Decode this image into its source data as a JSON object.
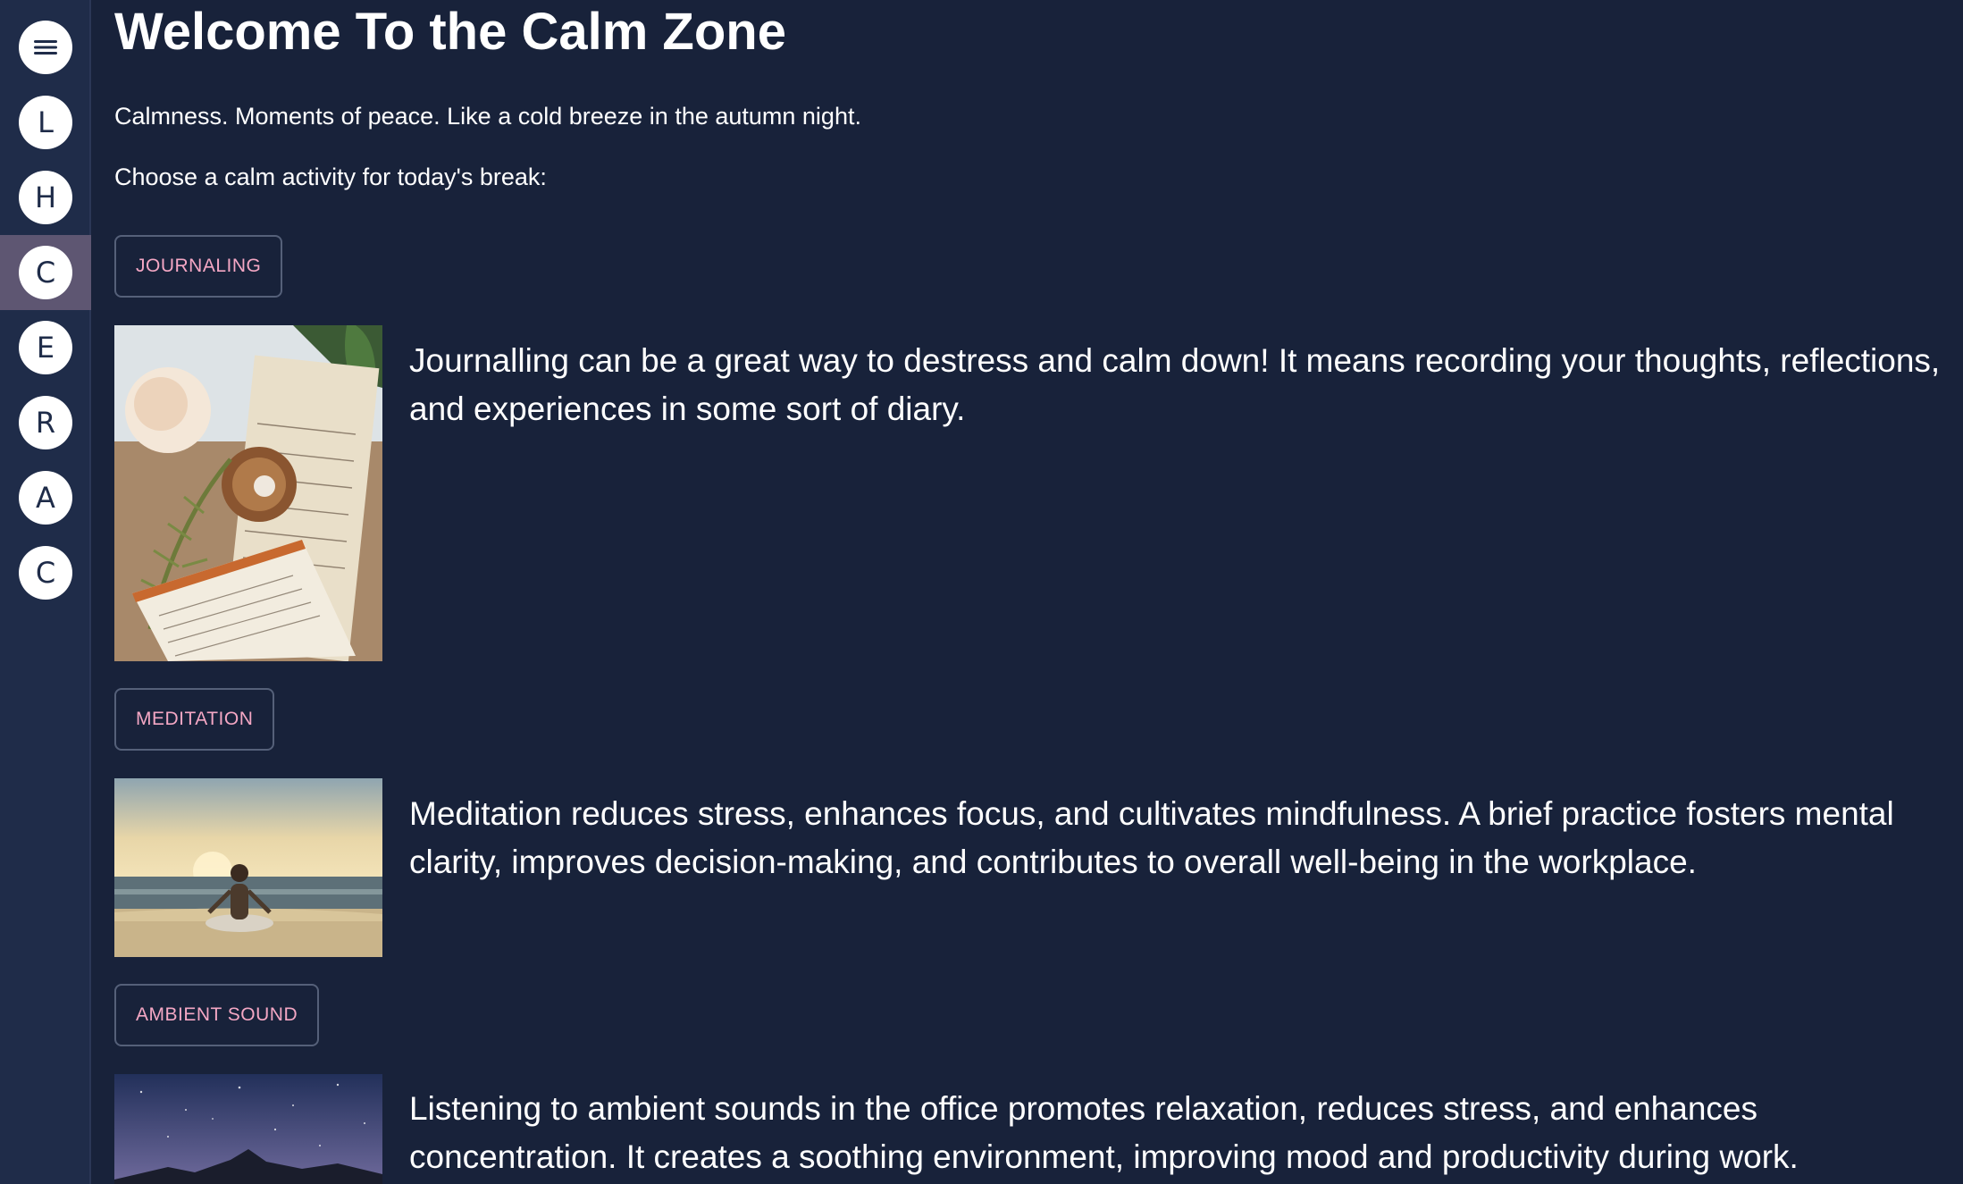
{
  "sidebar": {
    "items": [
      {
        "label": "≡",
        "icon": "hamburger-menu-icon"
      },
      {
        "label": "L"
      },
      {
        "label": "H"
      },
      {
        "label": "C",
        "active": true
      },
      {
        "label": "E"
      },
      {
        "label": "R"
      },
      {
        "label": "A"
      },
      {
        "label": "C"
      }
    ]
  },
  "header": {
    "title": "Welcome To the Calm Zone",
    "tagline": "Calmness. Moments of peace. Like a cold breeze in the autumn night.",
    "prompt": "Choose a calm activity for today's break:"
  },
  "activities": [
    {
      "button_label": "JOURNALING",
      "image": "journal-desk-photo",
      "description": "Journalling can be a great way to destress and calm down! It means recording your thoughts, reflections, and experiences in some sort of diary."
    },
    {
      "button_label": "MEDITATION",
      "image": "beach-meditation-photo",
      "description": "Meditation reduces stress, enhances focus, and cultivates mindfulness. A brief practice fosters mental clarity, improves decision-making, and contributes to overall well-being in the workplace."
    },
    {
      "button_label": "AMBIENT SOUND",
      "image": "night-sky-mountain-photo",
      "description": "Listening to ambient sounds in the office promotes relaxation, reduces stress, and enhances concentration. It creates a soothing environment, improving mood and productivity during work."
    }
  ],
  "colors": {
    "background": "#18223a",
    "sidebar": "#1f2c49",
    "sidebar_active": "#5e5672",
    "button_text": "#f4a7c4",
    "button_border": "#556079"
  }
}
